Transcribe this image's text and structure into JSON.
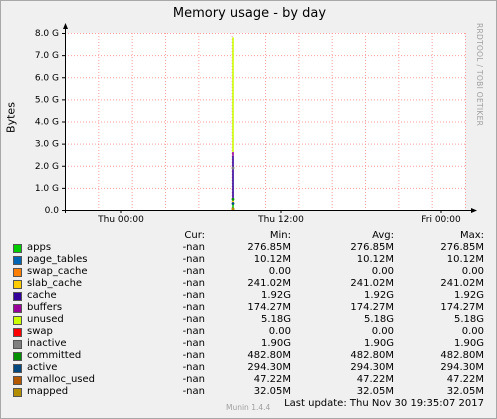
{
  "header": {
    "side_text": "RRDTOOL / TOBI OETIKER"
  },
  "chart_data": {
    "type": "line",
    "title": "Memory usage - by day",
    "ylabel": "Bytes",
    "xlabel": "",
    "y_unit": "bytes",
    "ylim": [
      0,
      8000000000.0
    ],
    "y_ticks": [
      "0.0",
      "1.0 G",
      "2.0 G",
      "3.0 G",
      "4.0 G",
      "5.0 G",
      "6.0 G",
      "7.0 G",
      "8.0 G"
    ],
    "x_ticks": [
      "Thu 00:00",
      "Thu 12:00",
      "Fri 00:00"
    ],
    "grid": true,
    "spike_position": "between Thu 00:00 and Thu 12:00 (approx Thu 08:00)",
    "series": [
      {
        "name": "apps",
        "color": "#00cc00",
        "cur": "-nan",
        "min": "276.85M",
        "avg": "276.85M",
        "max": "276.85M",
        "value": 276850000.0
      },
      {
        "name": "page_tables",
        "color": "#0066b3",
        "cur": "-nan",
        "min": "10.12M",
        "avg": "10.12M",
        "max": "10.12M",
        "value": 10120000.0
      },
      {
        "name": "swap_cache",
        "color": "#ff8000",
        "cur": "-nan",
        "min": "0.00",
        "avg": "0.00",
        "max": "0.00",
        "value": 0
      },
      {
        "name": "slab_cache",
        "color": "#ffcc00",
        "cur": "-nan",
        "min": "241.02M",
        "avg": "241.02M",
        "max": "241.02M",
        "value": 241020000.0
      },
      {
        "name": "cache",
        "color": "#330099",
        "cur": "-nan",
        "min": "1.92G",
        "avg": "1.92G",
        "max": "1.92G",
        "value": 1920000000.0
      },
      {
        "name": "buffers",
        "color": "#990099",
        "cur": "-nan",
        "min": "174.27M",
        "avg": "174.27M",
        "max": "174.27M",
        "value": 174270000.0
      },
      {
        "name": "unused",
        "color": "#ccff00",
        "cur": "-nan",
        "min": "5.18G",
        "avg": "5.18G",
        "max": "5.18G",
        "value": 5180000000.0
      },
      {
        "name": "swap",
        "color": "#ff0000",
        "cur": "-nan",
        "min": "0.00",
        "avg": "0.00",
        "max": "0.00",
        "value": 0
      },
      {
        "name": "inactive",
        "color": "#808080",
        "cur": "-nan",
        "min": "1.90G",
        "avg": "1.90G",
        "max": "1.90G",
        "value": 1900000000.0
      },
      {
        "name": "committed",
        "color": "#008f00",
        "cur": "-nan",
        "min": "482.80M",
        "avg": "482.80M",
        "max": "482.80M",
        "value": 482800000.0
      },
      {
        "name": "active",
        "color": "#00487d",
        "cur": "-nan",
        "min": "294.30M",
        "avg": "294.30M",
        "max": "294.30M",
        "value": 294300000.0
      },
      {
        "name": "vmalloc_used",
        "color": "#b35a00",
        "cur": "-nan",
        "min": "47.22M",
        "avg": "47.22M",
        "max": "47.22M",
        "value": 47220000.0
      },
      {
        "name": "mapped",
        "color": "#b38f00",
        "cur": "-nan",
        "min": "32.05M",
        "avg": "32.05M",
        "max": "32.05M",
        "value": 32050000.0
      }
    ],
    "legend_headers": {
      "cur": "Cur:",
      "min": "Min:",
      "avg": "Avg:",
      "max": "Max:"
    }
  },
  "footer": {
    "munin_version": "Munin 1.4.4",
    "last_update": "Last update:  Thu Nov 30 19:35:07 2017"
  }
}
